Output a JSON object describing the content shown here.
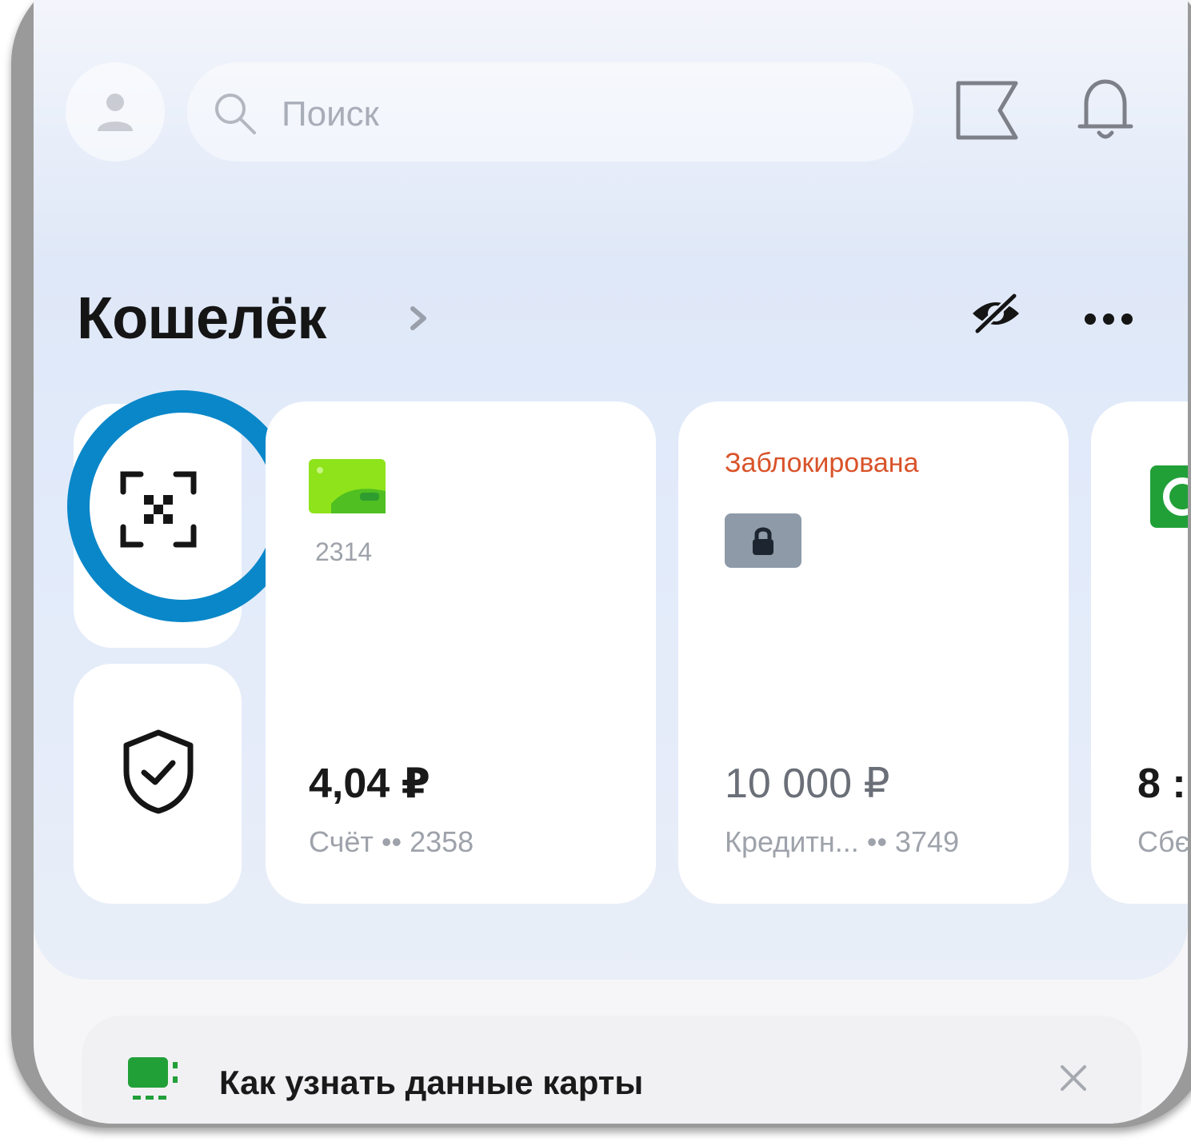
{
  "header": {
    "search_placeholder": "Поиск"
  },
  "wallet": {
    "title": "Кошелёк"
  },
  "cards": [
    {
      "number": "2314",
      "amount": "4,04 ₽",
      "subtitle": "Счёт •• 2358",
      "icon_color": "#8ee31b"
    },
    {
      "status": "Заблокирована",
      "amount": "10 000 ₽",
      "subtitle": "Кредитн... •• 3749"
    },
    {
      "amount": "8 :",
      "subtitle": "Сбє"
    }
  ],
  "banner": {
    "text": "Как узнать данные карты"
  },
  "colors": {
    "highlight_ring": "#0a87c9",
    "blocked_text": "#d9532a",
    "accent_green": "#21a038"
  }
}
